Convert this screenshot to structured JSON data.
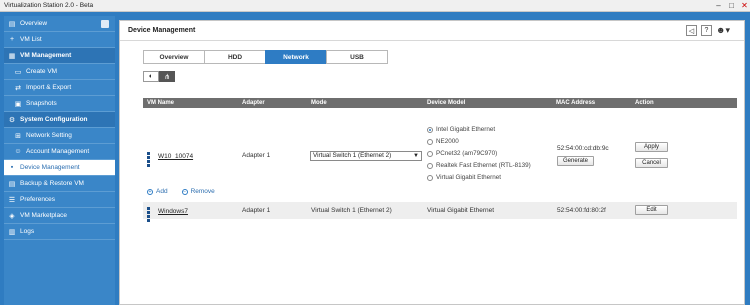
{
  "window": {
    "title": "Virtualization Station 2.0 - Beta"
  },
  "sidebar": {
    "items": [
      {
        "label": "Overview",
        "type": "top",
        "icon": "overview-icon"
      },
      {
        "label": "VM List",
        "type": "top",
        "icon": "plus-icon"
      },
      {
        "label": "VM Management",
        "type": "section",
        "icon": "vm-management-icon"
      },
      {
        "label": "Create VM",
        "type": "sub",
        "icon": "create-vm-icon"
      },
      {
        "label": "Import & Export",
        "type": "sub",
        "icon": "import-export-icon"
      },
      {
        "label": "Snapshots",
        "type": "sub",
        "icon": "snapshots-icon"
      },
      {
        "label": "System Configuration",
        "type": "section",
        "icon": "system-config-icon"
      },
      {
        "label": "Network Setting",
        "type": "sub",
        "icon": "network-icon"
      },
      {
        "label": "Account Management",
        "type": "sub",
        "icon": "account-icon"
      },
      {
        "label": "Device Management",
        "type": "top",
        "icon": "device-icon",
        "active": true
      },
      {
        "label": "Backup & Restore VM",
        "type": "top",
        "icon": "backup-icon"
      },
      {
        "label": "Preferences",
        "type": "top",
        "icon": "preferences-icon"
      },
      {
        "label": "VM Marketplace",
        "type": "top",
        "icon": "marketplace-icon"
      },
      {
        "label": "Logs",
        "type": "top",
        "icon": "logs-icon"
      }
    ]
  },
  "main": {
    "title": "Device Management",
    "tabs": [
      {
        "label": "Overview"
      },
      {
        "label": "HDD"
      },
      {
        "label": "Network",
        "active": true
      },
      {
        "label": "USB"
      }
    ],
    "table": {
      "headers": [
        "VM Name",
        "Adapter",
        "Mode",
        "Device Model",
        "MAC Address",
        "Action"
      ],
      "row1": {
        "vm_name": "W10_10074",
        "adapter": "Adapter 1",
        "mode": "Virtual Switch 1 (Ethernet 2)",
        "device_models": [
          "Intel Gigabit Ethernet",
          "NE2000",
          "PCnet32 (am79C970)",
          "Realtek Fast Ethernet (RTL-8139)",
          "Virtual Gigabit Ethernet"
        ],
        "selected_model": "Intel Gigabit Ethernet",
        "mac": "52:54:00:cd:db:9c",
        "generate_label": "Generate",
        "apply_label": "Apply",
        "cancel_label": "Cancel"
      },
      "add_label": "Add",
      "remove_label": "Remove",
      "row2": {
        "vm_name": "Windows7",
        "adapter": "Adapter 1",
        "mode": "Virtual Switch 1 (Ethernet 2)",
        "device_model": "Virtual Gigabit Ethernet",
        "mac": "52:54:00:fd:80:2f",
        "edit_label": "Edit"
      }
    }
  },
  "colors": {
    "accent": "#2e7cc4",
    "sidebar": "#3a86c8",
    "header": "#6e6e6e"
  }
}
